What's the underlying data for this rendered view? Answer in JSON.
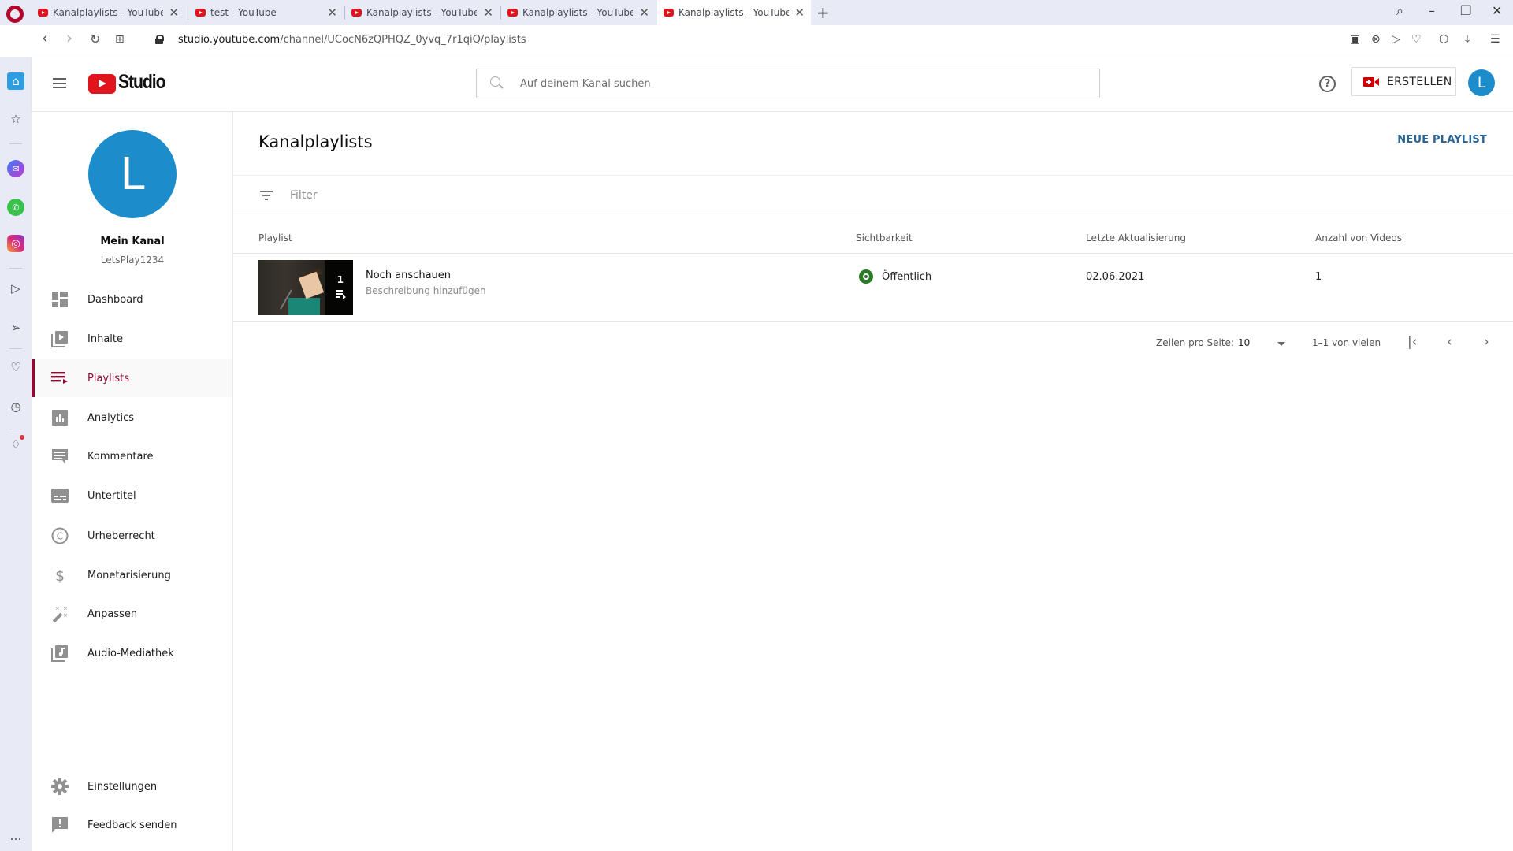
{
  "browser": {
    "tabs": [
      {
        "title": "Kanalplaylists - YouTube Studio",
        "active": false
      },
      {
        "title": "test - YouTube",
        "active": false
      },
      {
        "title": "Kanalplaylists - YouTube Studio",
        "active": false
      },
      {
        "title": "Kanalplaylists - YouTube Studio",
        "active": false
      },
      {
        "title": "Kanalplaylists - YouTube Studio",
        "active": true
      }
    ],
    "url_host": "studio.youtube.com",
    "url_path": "/channel/UCocN6zQPHQZ_0yvq_7r1qiQ/playlists",
    "icons": {
      "back": "‹",
      "forward": "›",
      "reload": "↻",
      "tabs": "⊞",
      "new_tab": "+",
      "search": "⌕",
      "minimize": "–",
      "restore": "❐",
      "close": "✕",
      "snapshot": "▣",
      "adblock": "⊗",
      "send": "▷",
      "heart": "♡",
      "cube": "⬡",
      "download": "⤓",
      "menu": "☰"
    }
  },
  "opera_sidebar": {
    "icons": [
      "home",
      "star",
      "messenger",
      "whatsapp",
      "instagram",
      "player",
      "send",
      "heart",
      "history",
      "lightbulb",
      "more"
    ],
    "glyphs": {
      "home": "⌂",
      "star": "☆",
      "messenger": "✉",
      "whatsapp": "✆",
      "instagram": "◎",
      "player": "▷",
      "send": "➢",
      "heart": "♡",
      "history": "◷",
      "lightbulb": "♢",
      "more": "…"
    }
  },
  "header": {
    "logo_text": "Studio",
    "search_placeholder": "Auf deinem Kanal suchen",
    "search_value": "",
    "help_glyph": "?",
    "create_label": "ERSTELLEN",
    "account_initial": "L",
    "accent_color": "#cc0000"
  },
  "sidebar": {
    "avatar_initial": "L",
    "avatar_color": "#1c8ccb",
    "channel_title": "Mein Kanal",
    "channel_handle": "LetsPlay1234",
    "items": [
      {
        "label": "Dashboard",
        "icon": "dashboard"
      },
      {
        "label": "Inhalte",
        "icon": "content"
      },
      {
        "label": "Playlists",
        "icon": "playlists",
        "active": true
      },
      {
        "label": "Analytics",
        "icon": "analytics"
      },
      {
        "label": "Kommentare",
        "icon": "comments"
      },
      {
        "label": "Untertitel",
        "icon": "subtitles"
      },
      {
        "label": "Urheberrecht",
        "icon": "copyright"
      },
      {
        "label": "Monetarisierung",
        "icon": "monetization"
      },
      {
        "label": "Anpassen",
        "icon": "customize"
      },
      {
        "label": "Audio-Mediathek",
        "icon": "audio-library"
      }
    ],
    "bottom_items": [
      {
        "label": "Einstellungen",
        "icon": "settings"
      },
      {
        "label": "Feedback senden",
        "icon": "feedback"
      }
    ],
    "active_color": "#8e0c31"
  },
  "main": {
    "title": "Kanalplaylists",
    "new_playlist_label": "NEUE PLAYLIST",
    "filter_placeholder": "Filter",
    "columns": [
      "Playlist",
      "Sichtbarkeit",
      "Letzte Aktualisierung",
      "Anzahl von Videos"
    ],
    "rows": [
      {
        "title": "Noch anschauen",
        "description": "Beschreibung hinzufügen",
        "video_count_badge": "1",
        "visibility": "Öffentlich",
        "visibility_color": "#2b7a27",
        "updated": "02.06.2021",
        "videos": "1"
      }
    ],
    "pagination": {
      "rows_per_page_label": "Zeilen pro Seite:",
      "rows_per_page_value": "10",
      "range_label": "1–1 von vielen",
      "first_glyph": "|‹",
      "prev_glyph": "‹",
      "next_glyph": "›"
    }
  }
}
